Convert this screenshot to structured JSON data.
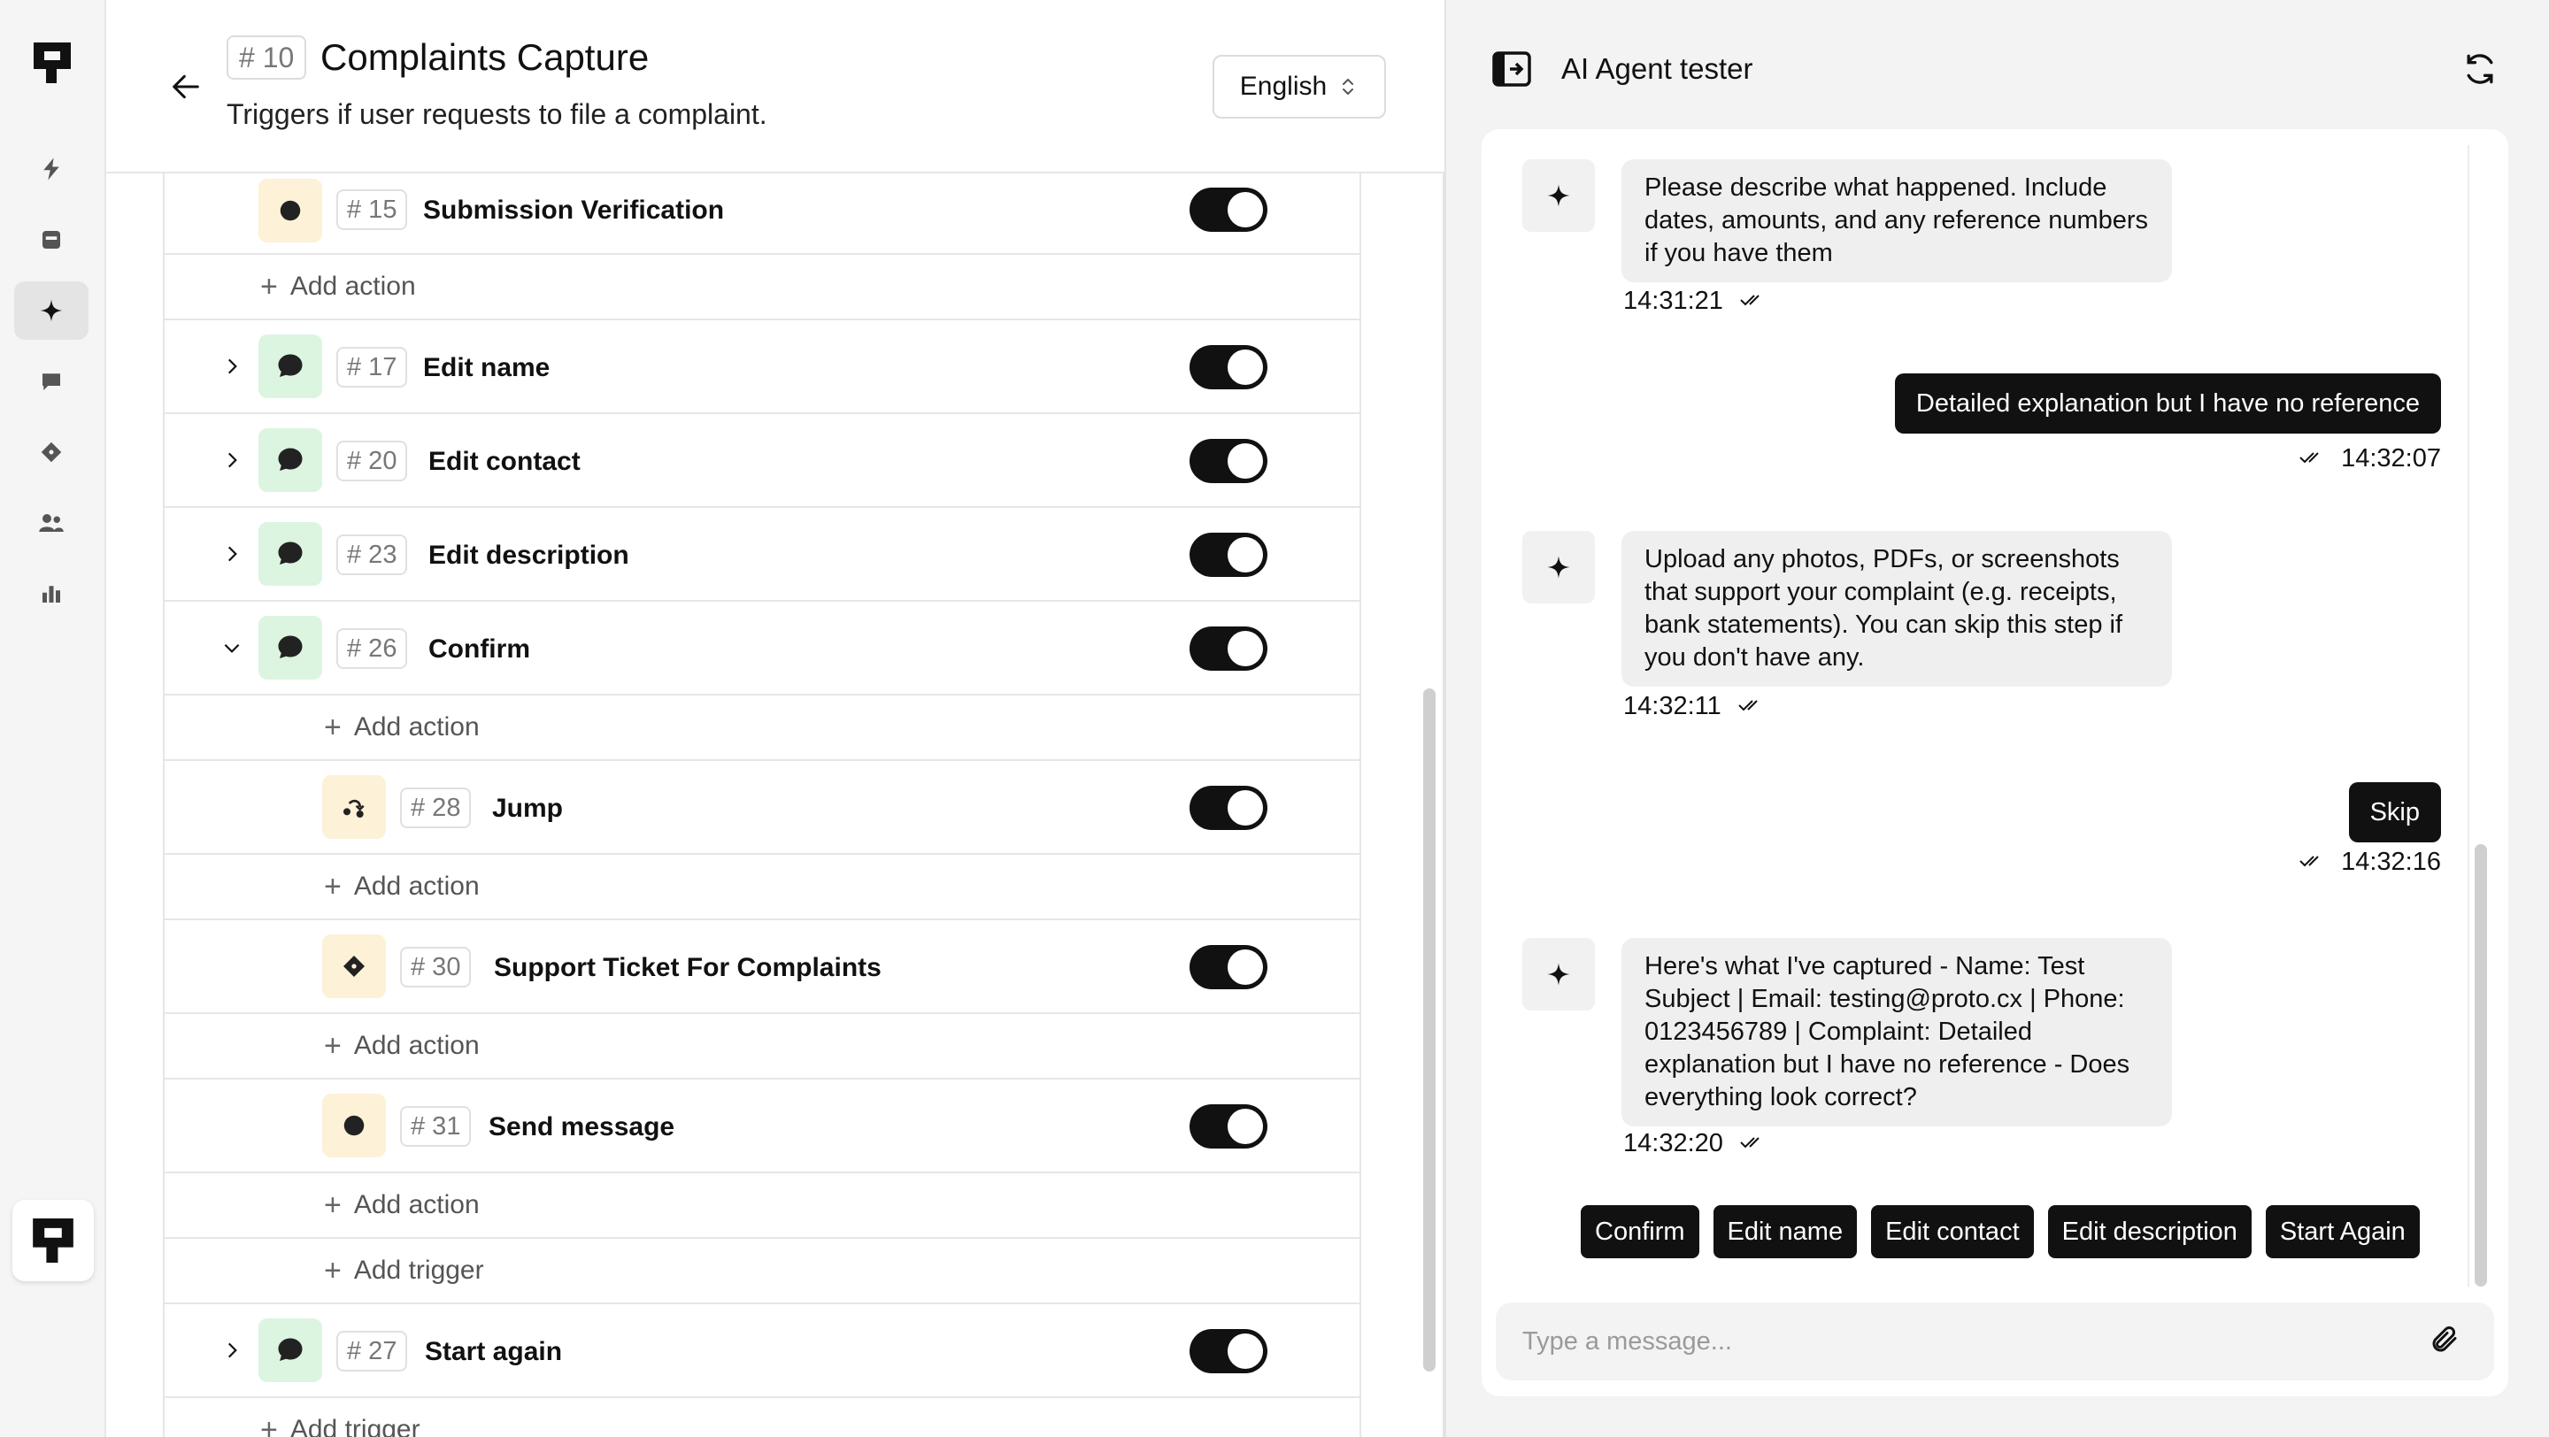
{
  "rail": {
    "icons": [
      "brand-logo",
      "lightning-icon",
      "inbox-icon",
      "sparkle-icon",
      "chat-icon",
      "ticket-icon",
      "users-icon",
      "bar-chart-icon",
      "brand-logo"
    ]
  },
  "header": {
    "number": "# 10",
    "title": "Complaints Capture",
    "subtitle": "Triggers if user requests to file a complaint.",
    "language": "English"
  },
  "rows": [
    {
      "number": "# 15",
      "name": "Submission Verification"
    },
    {
      "number": "# 17",
      "name": "Edit name"
    },
    {
      "number": "# 20",
      "name": "Edit contact"
    },
    {
      "number": "# 23",
      "name": "Edit description"
    },
    {
      "number": "# 26",
      "name": "Confirm"
    },
    {
      "number": "# 28",
      "name": "Jump"
    },
    {
      "number": "# 30",
      "name": "Support Ticket For Complaints"
    },
    {
      "number": "# 31",
      "name": "Send message"
    },
    {
      "number": "# 27",
      "name": "Start again"
    }
  ],
  "add_action_label": "Add action",
  "add_trigger_label": "Add trigger",
  "tester": {
    "title": "AI Agent tester",
    "messages": [
      {
        "from": "ai",
        "text": "Please describe what happened. Include dates, amounts, and any reference numbers if you have them",
        "time": "14:31:21"
      },
      {
        "from": "user",
        "text": "Detailed explanation but I have no reference",
        "time": "14:32:07"
      },
      {
        "from": "ai",
        "text": "Upload any photos, PDFs, or screenshots that support your complaint (e.g. receipts, bank statements). You can skip this step if you don't have any.",
        "time": "14:32:11"
      },
      {
        "from": "user",
        "text": "Skip",
        "time": "14:32:16"
      },
      {
        "from": "ai",
        "text": "Here's what I've captured - Name: Test Subject | Email: testing@proto.cx | Phone: 0123456789 | Complaint: Detailed explanation but I have no reference - Does everything look correct?",
        "time": "14:32:20"
      }
    ],
    "quick_replies": [
      "Confirm",
      "Edit name",
      "Edit contact",
      "Edit description",
      "Start Again"
    ],
    "input_placeholder": "Type a message..."
  }
}
